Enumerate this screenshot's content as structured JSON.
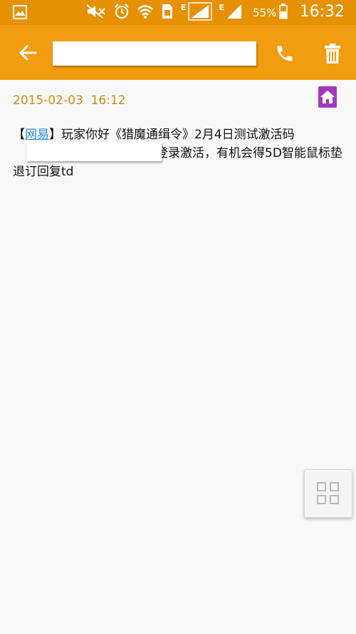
{
  "status_bar": {
    "battery": "55%",
    "time": "16:32",
    "network_label_1": "E",
    "network_label_2": "E",
    "icons": [
      "image-icon",
      "mute-icon",
      "alarm-icon",
      "wifi-icon",
      "sim-icon",
      "signal-icon",
      "signal-icon",
      "battery-icon"
    ]
  },
  "app_bar": {
    "search_value": "",
    "icons": [
      "back-arrow-icon",
      "phone-icon",
      "trash-icon"
    ],
    "color": "#f29c10"
  },
  "message": {
    "date": "2015-02-03",
    "time": "16:12",
    "bracket_open": "【",
    "link_text": "网易",
    "text_part_1": "】玩家你好《猎魔通缉令》2月4日测试激活码",
    "text_part_2": "请登录激活，有机会得5D智能鼠标垫  退订回复td"
  },
  "colors": {
    "status_bar": "#e59100",
    "date_text": "#c98c1a",
    "link": "#2a8fd8",
    "home_badge": "#a437c0"
  }
}
